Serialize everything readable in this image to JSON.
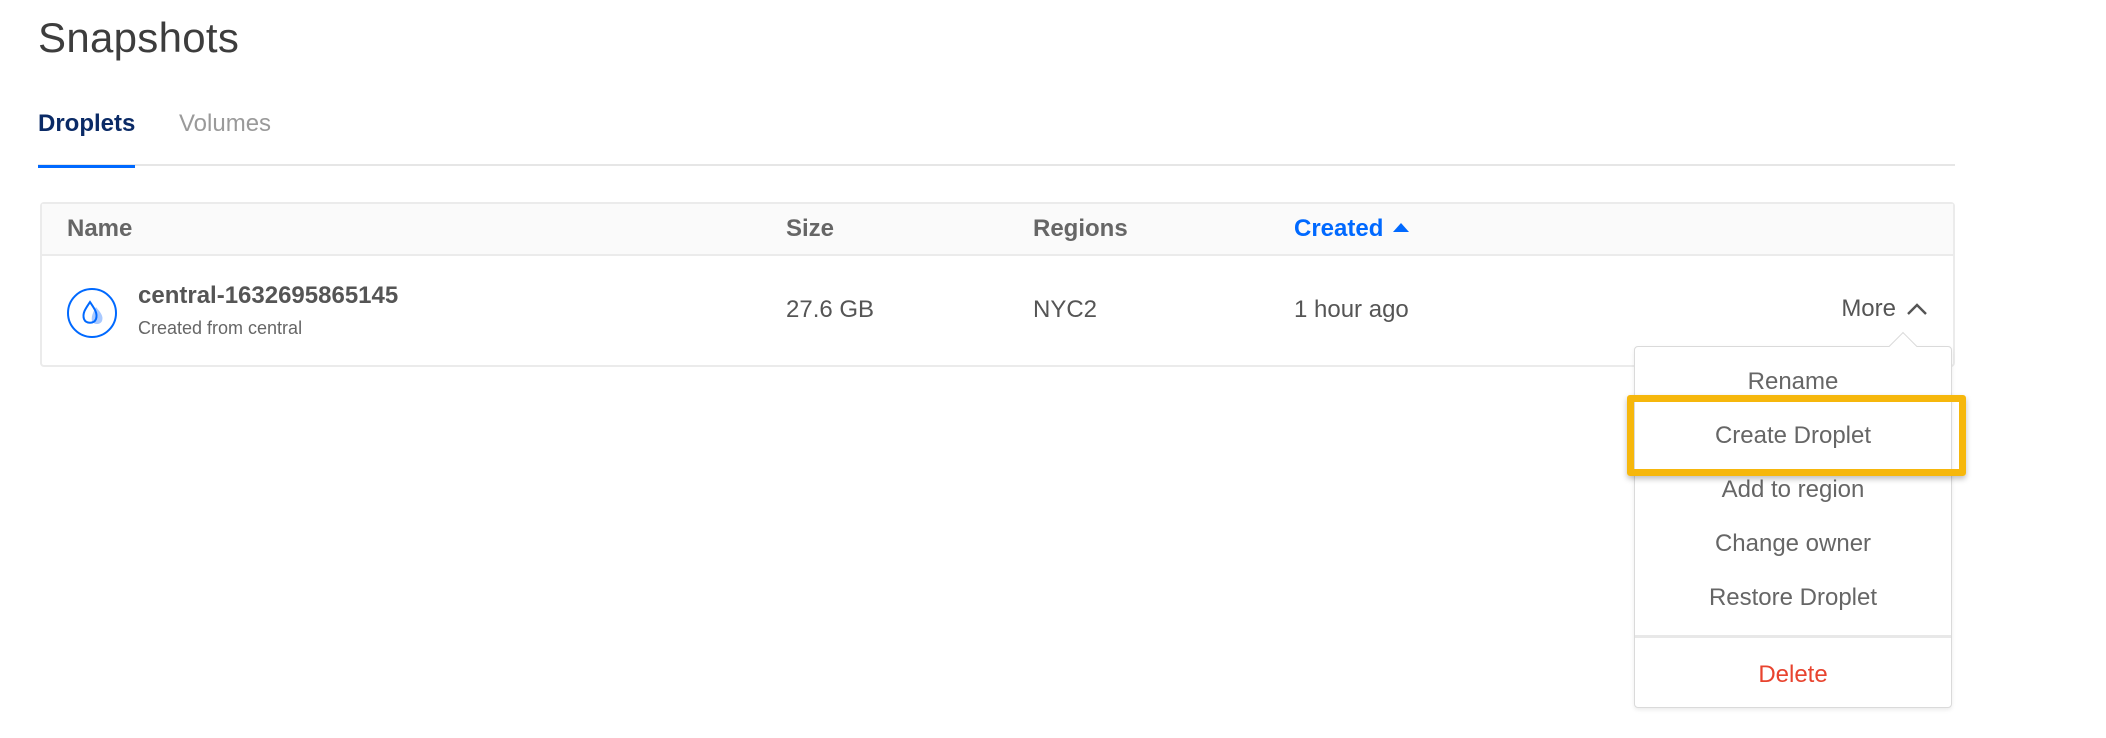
{
  "page": {
    "title": "Snapshots"
  },
  "tabs": [
    {
      "label": "Droplets",
      "active": true
    },
    {
      "label": "Volumes",
      "active": false
    }
  ],
  "table": {
    "columns": {
      "name": "Name",
      "size": "Size",
      "regions": "Regions",
      "created": "Created"
    },
    "sort": {
      "column": "Created",
      "direction": "ascending"
    },
    "rows": [
      {
        "icon": "droplet-icon",
        "name": "central-1632695865145",
        "subtitle": "Created from central",
        "size": "27.6 GB",
        "region": "NYC2",
        "created": "1 hour ago",
        "more_label": "More"
      }
    ]
  },
  "menu": {
    "items": [
      "Rename",
      "Create Droplet",
      "Add to region",
      "Change owner",
      "Restore Droplet"
    ],
    "danger_item": "Delete",
    "highlighted_item": "Create Droplet"
  },
  "colors": {
    "accent": "#0069ff",
    "danger": "#e8432e",
    "highlight": "#f6b70c",
    "active_tab_text": "#0a2a66"
  }
}
